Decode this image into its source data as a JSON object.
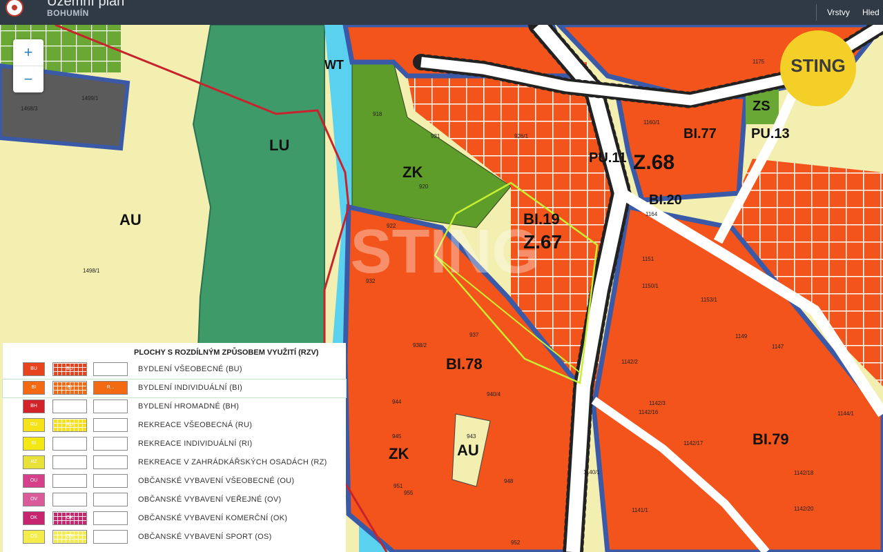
{
  "header": {
    "title": "Územní plán",
    "subtitle": "BOHUMÍN",
    "nav": [
      "Vrstvy",
      "Hled"
    ]
  },
  "zoom": {
    "in": "+",
    "out": "−"
  },
  "watermark": {
    "badge": "STING",
    "center": "STING"
  },
  "map": {
    "zones": [
      "AU",
      "LU",
      "WT",
      "ZK",
      "BI.19",
      "Z.67",
      "BI.78",
      "ZK",
      "AU",
      "BI.79",
      "PU.11",
      "Z.68",
      "BI.77",
      "ZS",
      "PU.13",
      "BI.20"
    ],
    "parcels": [
      "1498/1",
      "1499/1",
      "1468/3",
      "918",
      "920",
      "921",
      "926/1",
      "922",
      "932",
      "937",
      "938/2",
      "940/4",
      "943",
      "944",
      "945",
      "948",
      "951",
      "952",
      "955",
      "1151",
      "1150/1",
      "1153/1",
      "1149",
      "1147",
      "1142/2",
      "1142/3",
      "1142/16",
      "1144/1",
      "1142/17",
      "1142/18",
      "1142/20",
      "1140/1",
      "1141/1",
      "1160/1",
      "1164",
      "1175"
    ]
  },
  "legend": {
    "title": "PLOCHY S ROZDÍLNÝM ZPŮSOBEM VYUŽITÍ (RZV)",
    "items": [
      {
        "label": "BYDLENÍ VŠEOBECNÉ (BU)",
        "code": "BU",
        "color": "#e8431f",
        "hatch": true,
        "btn": ""
      },
      {
        "label": "BYDLENÍ INDIVIDUÁLNÍ (BI)",
        "code": "BI",
        "color": "#f46a12",
        "hatch": true,
        "btn": "R..."
      },
      {
        "label": "BYDLENÍ HROMADNÉ (BH)",
        "code": "BH",
        "color": "#d2232a",
        "hatch": false,
        "btn": ""
      },
      {
        "label": "REKREACE VŠEOBECNÁ (RU)",
        "code": "RU",
        "color": "#f5e219",
        "hatch": true,
        "btn": ""
      },
      {
        "label": "REKREACE INDIVIDUÁLNÍ (RI)",
        "code": "RI",
        "color": "#f3e816",
        "hatch": false,
        "btn": ""
      },
      {
        "label": "REKREACE V ZAHRÁDKÁŘSKÝCH OSADÁCH (RZ)",
        "code": "RZ",
        "color": "#e7e13a",
        "hatch": false,
        "btn": ""
      },
      {
        "label": "OBČANSKÉ VYBAVENÍ VŠEOBECNÉ (OU)",
        "code": "OU",
        "color": "#d6408a",
        "hatch": false,
        "btn": ""
      },
      {
        "label": "OBČANSKÉ VYBAVENÍ VEŘEJNÉ (OV)",
        "code": "OV",
        "color": "#db5b9a",
        "hatch": false,
        "btn": ""
      },
      {
        "label": "OBČANSKÉ VYBAVENÍ KOMERČNÍ (OK)",
        "code": "OK",
        "color": "#c7256f",
        "hatch": true,
        "btn": ""
      },
      {
        "label": "OBČANSKÉ VYBAVENÍ SPORT (OS)",
        "code": "OS",
        "color": "#f3ec4a",
        "hatch": true,
        "btn": ""
      }
    ]
  },
  "colors": {
    "header": "#2f3a45",
    "bi": "#f2541b",
    "au": "#f3efb1",
    "lu": "#3f9a6a",
    "zk": "#5e9d2a",
    "water": "#5ad2ef",
    "street": "#ffffff",
    "boundary": "#3a5aa8",
    "highlight": "#c6ef33",
    "sting": "#f3cf27"
  }
}
